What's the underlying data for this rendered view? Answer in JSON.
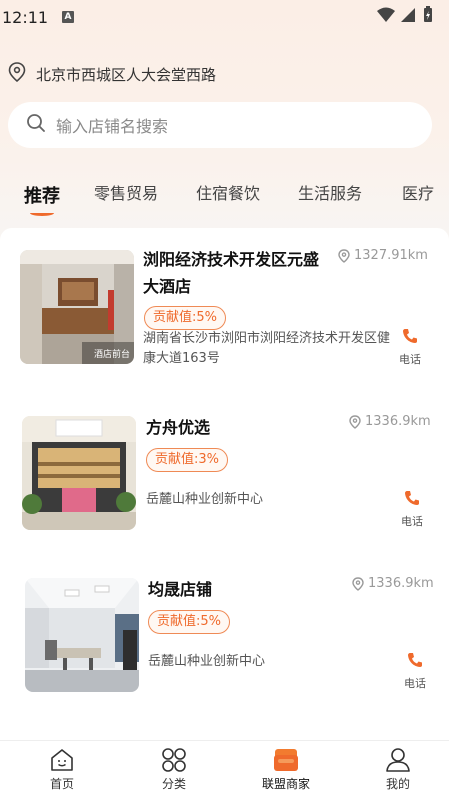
{
  "status_bar": {
    "time": "12:11",
    "notification_letter": "A"
  },
  "location": {
    "text": "北京市西城区人大会堂西路"
  },
  "search": {
    "placeholder": "输入店铺名搜索"
  },
  "category_tabs": [
    {
      "label": "推荐",
      "active": true
    },
    {
      "label": "零售贸易",
      "active": false
    },
    {
      "label": "住宿餐饮",
      "active": false
    },
    {
      "label": "生活服务",
      "active": false
    },
    {
      "label": "医疗",
      "active": false
    }
  ],
  "stores": [
    {
      "name": "浏阳经济技术开发区元盛大酒店",
      "distance": "1327.91km",
      "contribution": "贡献值:5%",
      "address": "湖南省长沙市浏阳市浏阳经济技术开发区健康大道163号",
      "call_label": "电话",
      "image_caption": "酒店前台"
    },
    {
      "name": "方舟优选",
      "distance": "1336.9km",
      "contribution": "贡献值:3%",
      "address": "岳麓山种业创新中心",
      "call_label": "电话"
    },
    {
      "name": "均晟店铺",
      "distance": "1336.9km",
      "contribution": "贡献值:5%",
      "address": "岳麓山种业创新中心",
      "call_label": "电话"
    }
  ],
  "bottom_nav": [
    {
      "label": "首页",
      "icon": "home-icon"
    },
    {
      "label": "分类",
      "icon": "category-icon"
    },
    {
      "label": "联盟商家",
      "icon": "shop-icon",
      "active": true
    },
    {
      "label": "我的",
      "icon": "user-icon"
    }
  ],
  "colors": {
    "accent": "#ef6a2c",
    "header_bg": "#fbeee6"
  }
}
